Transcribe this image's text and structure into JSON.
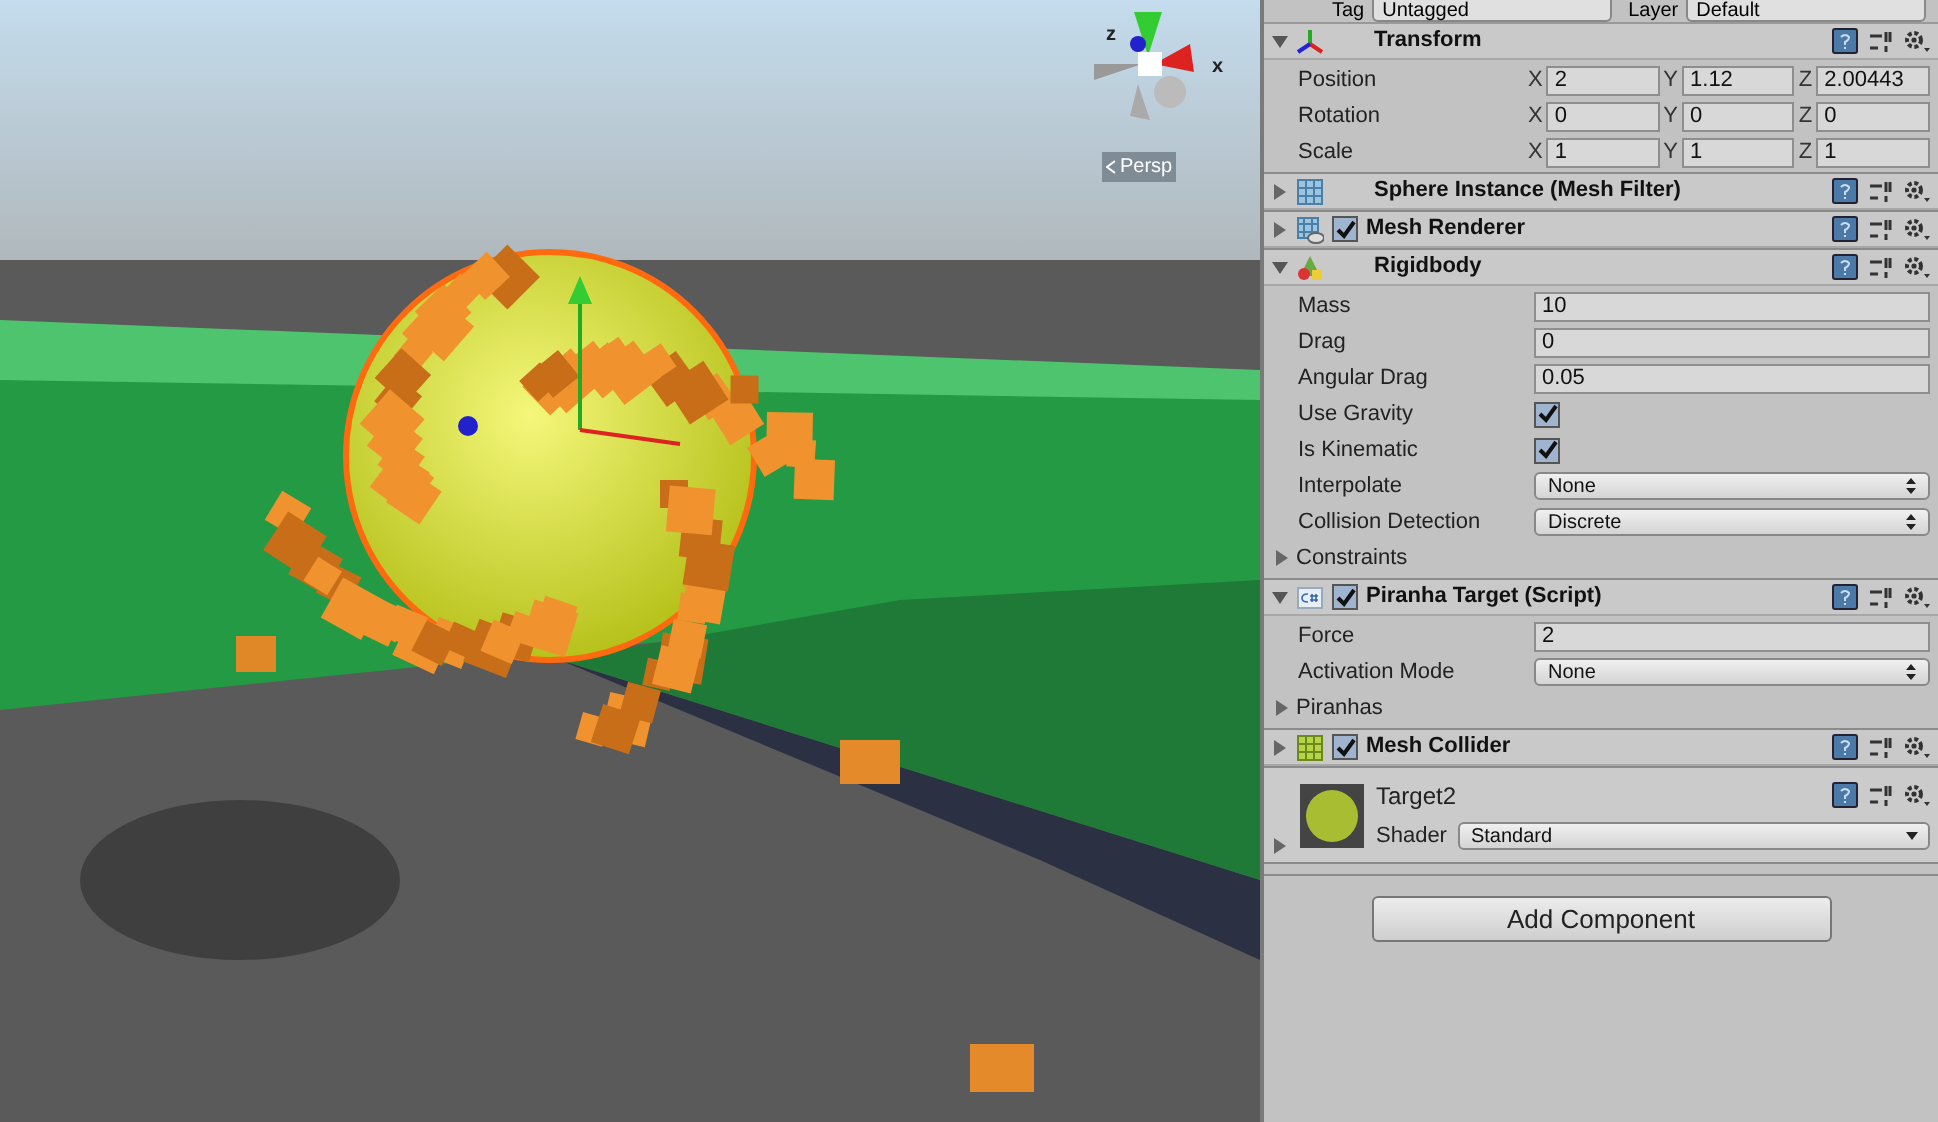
{
  "scene": {
    "view_label": "Persp",
    "gizmo_labels": [
      "z",
      "x"
    ]
  },
  "inspector": {
    "header": {
      "tag_label": "Tag",
      "tag_value": "Untagged",
      "layer_label": "Layer",
      "layer_value": "Default"
    },
    "components": [
      {
        "kind": "transform",
        "name": "Transform",
        "expanded": true,
        "rows": [
          {
            "kind": "vector3",
            "label": "Position",
            "axes": [
              {
                "axis": "X",
                "value": "2"
              },
              {
                "axis": "Y",
                "value": "1.12"
              },
              {
                "axis": "Z",
                "value": "2.00443"
              }
            ]
          },
          {
            "kind": "vector3",
            "label": "Rotation",
            "axes": [
              {
                "axis": "X",
                "value": "0"
              },
              {
                "axis": "Y",
                "value": "0"
              },
              {
                "axis": "Z",
                "value": "0"
              }
            ]
          },
          {
            "kind": "vector3",
            "label": "Scale",
            "axes": [
              {
                "axis": "X",
                "value": "1"
              },
              {
                "axis": "Y",
                "value": "1"
              },
              {
                "axis": "Z",
                "value": "1"
              }
            ]
          }
        ]
      },
      {
        "kind": "mesh_filter",
        "name": "Sphere Instance (Mesh Filter)",
        "expanded": false
      },
      {
        "kind": "mesh_renderer",
        "name": "Mesh Renderer",
        "expanded": false,
        "enabled": true
      },
      {
        "kind": "rigidbody",
        "name": "Rigidbody",
        "expanded": true,
        "rows": [
          {
            "kind": "text",
            "label": "Mass",
            "value": "10"
          },
          {
            "kind": "text",
            "label": "Drag",
            "value": "0"
          },
          {
            "kind": "text",
            "label": "Angular Drag",
            "value": "0.05"
          },
          {
            "kind": "checkbox",
            "label": "Use Gravity",
            "checked": true
          },
          {
            "kind": "checkbox",
            "label": "Is Kinematic",
            "checked": true
          },
          {
            "kind": "dropdown",
            "label": "Interpolate",
            "value": "None"
          },
          {
            "kind": "dropdown",
            "label": "Collision Detection",
            "value": "Discrete"
          },
          {
            "kind": "foldout",
            "label": "Constraints",
            "expanded": false
          }
        ]
      },
      {
        "kind": "script",
        "name": "Piranha Target (Script)",
        "expanded": true,
        "enabled": true,
        "rows": [
          {
            "kind": "text",
            "label": "Force",
            "value": "2"
          },
          {
            "kind": "dropdown",
            "label": "Activation Mode",
            "value": "None"
          },
          {
            "kind": "foldout",
            "label": "Piranhas",
            "expanded": false
          }
        ]
      },
      {
        "kind": "mesh_collider",
        "name": "Mesh Collider",
        "expanded": false,
        "enabled": true
      }
    ],
    "material": {
      "name": "Target2",
      "shader_label": "Shader",
      "shader_value": "Standard",
      "expanded": false
    },
    "add_button": "Add Component"
  }
}
